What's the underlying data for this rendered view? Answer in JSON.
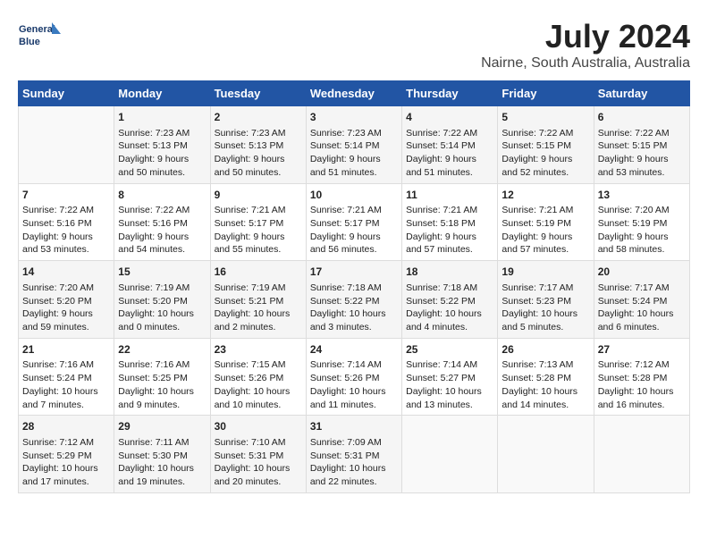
{
  "logo": {
    "line1": "General",
    "line2": "Blue"
  },
  "title": "July 2024",
  "subtitle": "Nairne, South Australia, Australia",
  "header": {
    "accent_color": "#2255a4"
  },
  "weekdays": [
    "Sunday",
    "Monday",
    "Tuesday",
    "Wednesday",
    "Thursday",
    "Friday",
    "Saturday"
  ],
  "weeks": [
    [
      {
        "day": "",
        "content": ""
      },
      {
        "day": "1",
        "content": "Sunrise: 7:23 AM\nSunset: 5:13 PM\nDaylight: 9 hours\nand 50 minutes."
      },
      {
        "day": "2",
        "content": "Sunrise: 7:23 AM\nSunset: 5:13 PM\nDaylight: 9 hours\nand 50 minutes."
      },
      {
        "day": "3",
        "content": "Sunrise: 7:23 AM\nSunset: 5:14 PM\nDaylight: 9 hours\nand 51 minutes."
      },
      {
        "day": "4",
        "content": "Sunrise: 7:22 AM\nSunset: 5:14 PM\nDaylight: 9 hours\nand 51 minutes."
      },
      {
        "day": "5",
        "content": "Sunrise: 7:22 AM\nSunset: 5:15 PM\nDaylight: 9 hours\nand 52 minutes."
      },
      {
        "day": "6",
        "content": "Sunrise: 7:22 AM\nSunset: 5:15 PM\nDaylight: 9 hours\nand 53 minutes."
      }
    ],
    [
      {
        "day": "7",
        "content": "Sunrise: 7:22 AM\nSunset: 5:16 PM\nDaylight: 9 hours\nand 53 minutes."
      },
      {
        "day": "8",
        "content": "Sunrise: 7:22 AM\nSunset: 5:16 PM\nDaylight: 9 hours\nand 54 minutes."
      },
      {
        "day": "9",
        "content": "Sunrise: 7:21 AM\nSunset: 5:17 PM\nDaylight: 9 hours\nand 55 minutes."
      },
      {
        "day": "10",
        "content": "Sunrise: 7:21 AM\nSunset: 5:17 PM\nDaylight: 9 hours\nand 56 minutes."
      },
      {
        "day": "11",
        "content": "Sunrise: 7:21 AM\nSunset: 5:18 PM\nDaylight: 9 hours\nand 57 minutes."
      },
      {
        "day": "12",
        "content": "Sunrise: 7:21 AM\nSunset: 5:19 PM\nDaylight: 9 hours\nand 57 minutes."
      },
      {
        "day": "13",
        "content": "Sunrise: 7:20 AM\nSunset: 5:19 PM\nDaylight: 9 hours\nand 58 minutes."
      }
    ],
    [
      {
        "day": "14",
        "content": "Sunrise: 7:20 AM\nSunset: 5:20 PM\nDaylight: 9 hours\nand 59 minutes."
      },
      {
        "day": "15",
        "content": "Sunrise: 7:19 AM\nSunset: 5:20 PM\nDaylight: 10 hours\nand 0 minutes."
      },
      {
        "day": "16",
        "content": "Sunrise: 7:19 AM\nSunset: 5:21 PM\nDaylight: 10 hours\nand 2 minutes."
      },
      {
        "day": "17",
        "content": "Sunrise: 7:18 AM\nSunset: 5:22 PM\nDaylight: 10 hours\nand 3 minutes."
      },
      {
        "day": "18",
        "content": "Sunrise: 7:18 AM\nSunset: 5:22 PM\nDaylight: 10 hours\nand 4 minutes."
      },
      {
        "day": "19",
        "content": "Sunrise: 7:17 AM\nSunset: 5:23 PM\nDaylight: 10 hours\nand 5 minutes."
      },
      {
        "day": "20",
        "content": "Sunrise: 7:17 AM\nSunset: 5:24 PM\nDaylight: 10 hours\nand 6 minutes."
      }
    ],
    [
      {
        "day": "21",
        "content": "Sunrise: 7:16 AM\nSunset: 5:24 PM\nDaylight: 10 hours\nand 7 minutes."
      },
      {
        "day": "22",
        "content": "Sunrise: 7:16 AM\nSunset: 5:25 PM\nDaylight: 10 hours\nand 9 minutes."
      },
      {
        "day": "23",
        "content": "Sunrise: 7:15 AM\nSunset: 5:26 PM\nDaylight: 10 hours\nand 10 minutes."
      },
      {
        "day": "24",
        "content": "Sunrise: 7:14 AM\nSunset: 5:26 PM\nDaylight: 10 hours\nand 11 minutes."
      },
      {
        "day": "25",
        "content": "Sunrise: 7:14 AM\nSunset: 5:27 PM\nDaylight: 10 hours\nand 13 minutes."
      },
      {
        "day": "26",
        "content": "Sunrise: 7:13 AM\nSunset: 5:28 PM\nDaylight: 10 hours\nand 14 minutes."
      },
      {
        "day": "27",
        "content": "Sunrise: 7:12 AM\nSunset: 5:28 PM\nDaylight: 10 hours\nand 16 minutes."
      }
    ],
    [
      {
        "day": "28",
        "content": "Sunrise: 7:12 AM\nSunset: 5:29 PM\nDaylight: 10 hours\nand 17 minutes."
      },
      {
        "day": "29",
        "content": "Sunrise: 7:11 AM\nSunset: 5:30 PM\nDaylight: 10 hours\nand 19 minutes."
      },
      {
        "day": "30",
        "content": "Sunrise: 7:10 AM\nSunset: 5:31 PM\nDaylight: 10 hours\nand 20 minutes."
      },
      {
        "day": "31",
        "content": "Sunrise: 7:09 AM\nSunset: 5:31 PM\nDaylight: 10 hours\nand 22 minutes."
      },
      {
        "day": "",
        "content": ""
      },
      {
        "day": "",
        "content": ""
      },
      {
        "day": "",
        "content": ""
      }
    ]
  ]
}
